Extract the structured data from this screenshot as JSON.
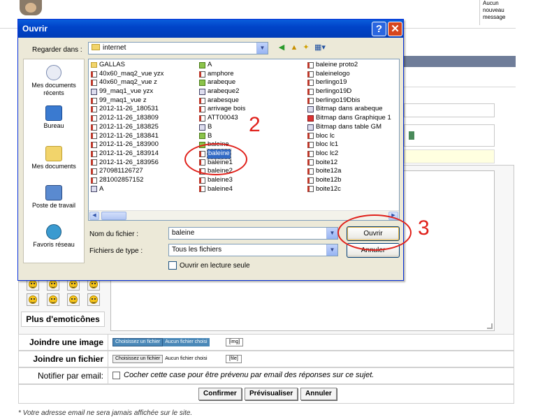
{
  "background": {
    "message_box": "Aucun nouveau message",
    "emoticons_label": "Plus d'emoticônes",
    "attach_image_label": "Joindre une image",
    "attach_file_label": "Joindre un fichier",
    "notify_label": "Notifier par email:",
    "choose_file": "Choisissez un fichier",
    "no_file": "Aucun fichier choisi",
    "img_tag": "[img]",
    "file_tag": "[file]",
    "notify_text": "Cocher cette case pour être prévenu par email des réponses sur ce sujet.",
    "confirm": "Confirmer",
    "preview": "Prévisualiser",
    "cancel": "Annuler",
    "footnote": "*  Votre adresse email ne sera jamais affichée sur le site."
  },
  "dialog": {
    "title": "Ouvrir",
    "look_in_label": "Regarder dans :",
    "look_in_value": "internet",
    "places": [
      {
        "label": "Mes documents récents",
        "icon": "recent-documents-icon"
      },
      {
        "label": "Bureau",
        "icon": "desktop-icon"
      },
      {
        "label": "Mes documents",
        "icon": "my-documents-icon"
      },
      {
        "label": "Poste de travail",
        "icon": "my-computer-icon"
      },
      {
        "label": "Favoris réseau",
        "icon": "network-places-icon"
      }
    ],
    "columns": [
      [
        {
          "name": "GALLAS",
          "type": "folder"
        },
        {
          "name": "40x60_maq2_vue yzx",
          "type": "doc"
        },
        {
          "name": "40x60_maq2_vue z",
          "type": "doc"
        },
        {
          "name": "99_maq1_vue yzx",
          "type": "sc"
        },
        {
          "name": "99_maq1_vue z",
          "type": "doc"
        },
        {
          "name": "2012-11-26_180531",
          "type": "doc"
        },
        {
          "name": "2012-11-26_183809",
          "type": "doc"
        },
        {
          "name": "2012-11-26_183825",
          "type": "doc"
        },
        {
          "name": "2012-11-26_183841",
          "type": "doc"
        },
        {
          "name": "2012-11-26_183900",
          "type": "doc"
        },
        {
          "name": "2012-11-26_183914",
          "type": "doc"
        },
        {
          "name": "2012-11-26_183956",
          "type": "doc"
        },
        {
          "name": "270981126727",
          "type": "doc"
        },
        {
          "name": "281002857152",
          "type": "doc"
        },
        {
          "name": "A",
          "type": "sc"
        }
      ],
      [
        {
          "name": "A",
          "type": "img"
        },
        {
          "name": "amphore",
          "type": "doc"
        },
        {
          "name": "arabeque",
          "type": "img"
        },
        {
          "name": "arabeque2",
          "type": "sc"
        },
        {
          "name": "arabesque",
          "type": "doc"
        },
        {
          "name": "arrivage bois",
          "type": "doc"
        },
        {
          "name": "ATT00043",
          "type": "doc"
        },
        {
          "name": "B",
          "type": "sc"
        },
        {
          "name": "B",
          "type": "img"
        },
        {
          "name": "baleine",
          "type": "img"
        },
        {
          "name": "baleine",
          "type": "doc",
          "selected": true
        },
        {
          "name": "baleine1",
          "type": "doc"
        },
        {
          "name": "baleine2",
          "type": "doc"
        },
        {
          "name": "baleine3",
          "type": "doc"
        },
        {
          "name": "baleine4",
          "type": "doc"
        }
      ],
      [
        {
          "name": "baleine proto2",
          "type": "doc"
        },
        {
          "name": "baleinelogo",
          "type": "doc"
        },
        {
          "name": "berlingo19",
          "type": "doc"
        },
        {
          "name": "berlingo19D",
          "type": "doc"
        },
        {
          "name": "berlingo19Dbis",
          "type": "doc"
        },
        {
          "name": "Bitmap dans arabeque",
          "type": "sc"
        },
        {
          "name": "Bitmap dans Graphique 1",
          "type": "pdf"
        },
        {
          "name": "Bitmap dans table GM",
          "type": "sc"
        },
        {
          "name": "bloc lc",
          "type": "doc"
        },
        {
          "name": "bloc lc1",
          "type": "doc"
        },
        {
          "name": "bloc lc2",
          "type": "doc"
        },
        {
          "name": "boite12",
          "type": "doc"
        },
        {
          "name": "boite12a",
          "type": "doc"
        },
        {
          "name": "boite12b",
          "type": "doc"
        },
        {
          "name": "boite12c",
          "type": "doc"
        }
      ]
    ],
    "filename_label": "Nom du fichier :",
    "filename_value": "baleine",
    "filetype_label": "Fichiers de type :",
    "filetype_value": "Tous les fichiers",
    "open_button": "Ouvrir",
    "cancel_button": "Annuler",
    "readonly_label": "Ouvrir en lecture seule"
  },
  "annotations": {
    "step2": "2",
    "step3": "3"
  }
}
